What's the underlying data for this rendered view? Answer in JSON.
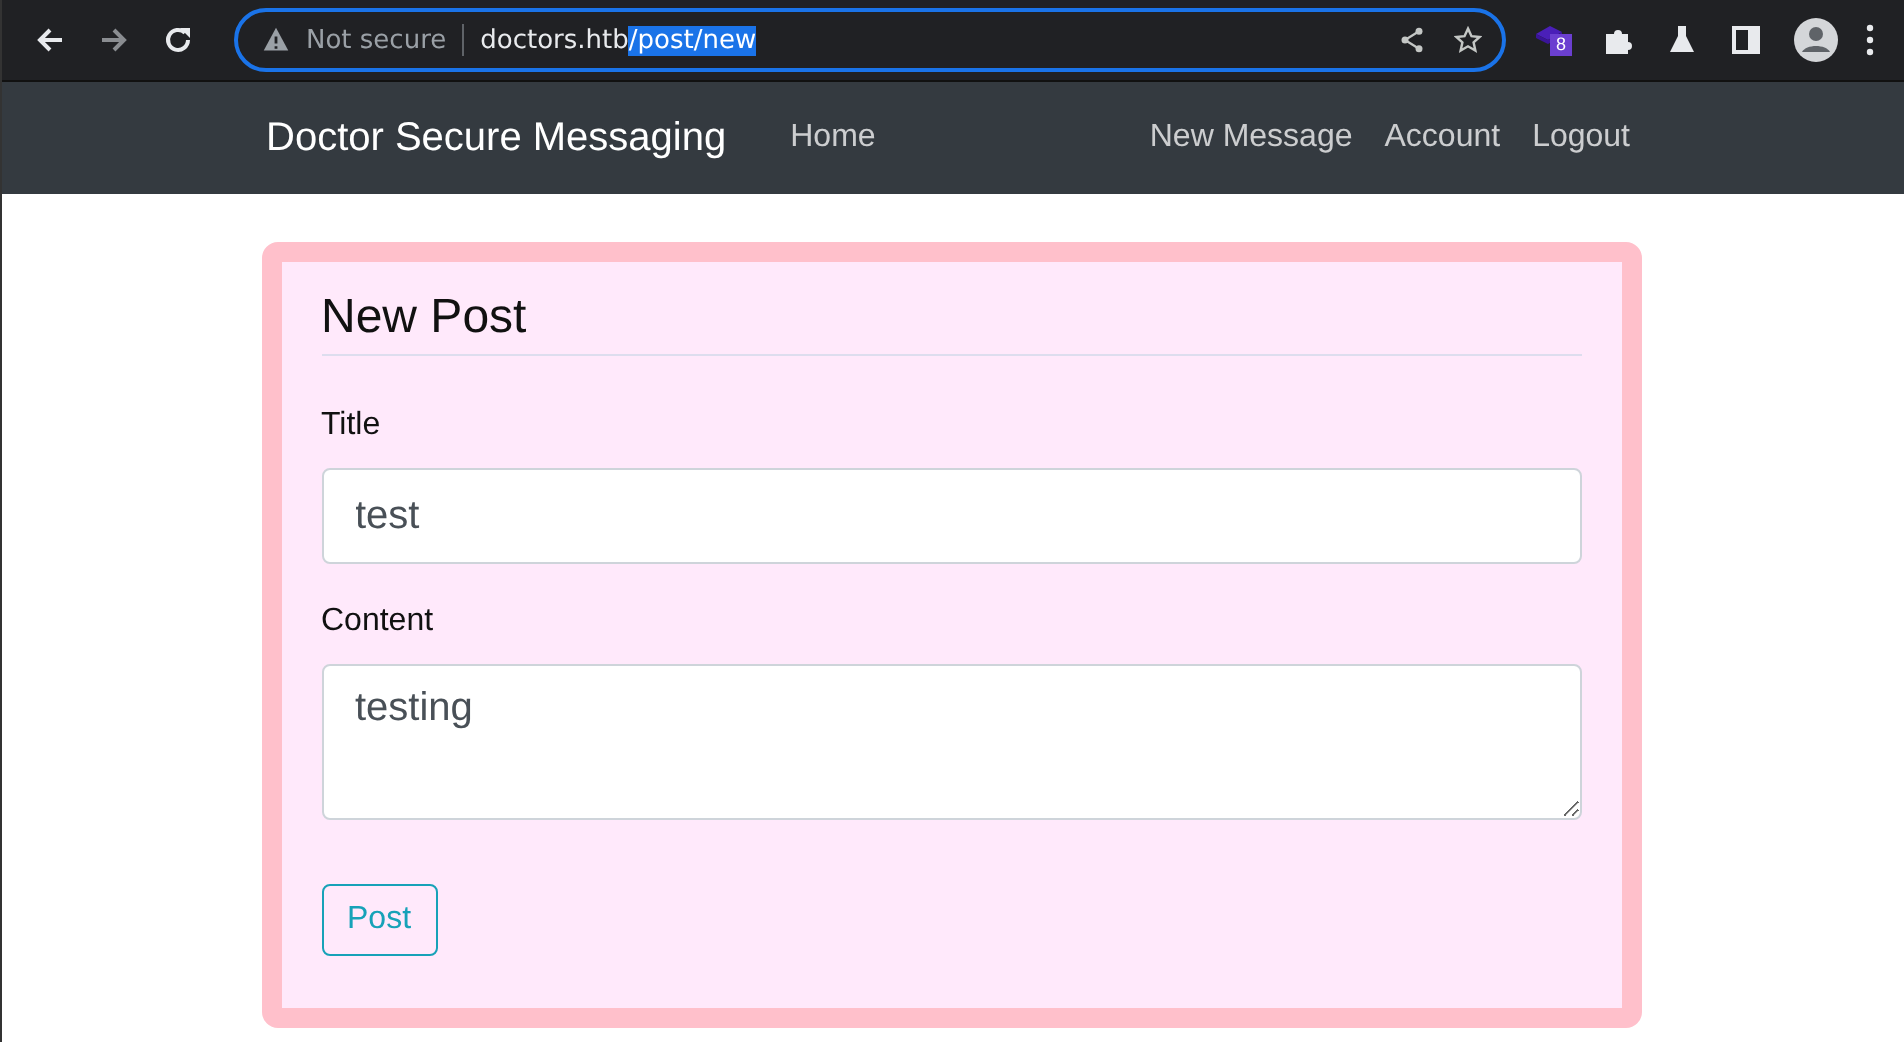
{
  "browser": {
    "security": "Not secure",
    "url_host": "doctors.htb",
    "url_path": "/post/new",
    "url_path_selected": true,
    "extension_badge": "8"
  },
  "navbar": {
    "brand": "Doctor Secure Messaging",
    "left_links": [
      "Home"
    ],
    "right_links": [
      "New Message",
      "Account",
      "Logout"
    ]
  },
  "form": {
    "legend": "New Post",
    "fields": [
      {
        "kind": "input",
        "label": "Title",
        "value": "test"
      },
      {
        "kind": "textarea",
        "label": "Content",
        "value": "testing"
      }
    ],
    "submit": "Post"
  }
}
